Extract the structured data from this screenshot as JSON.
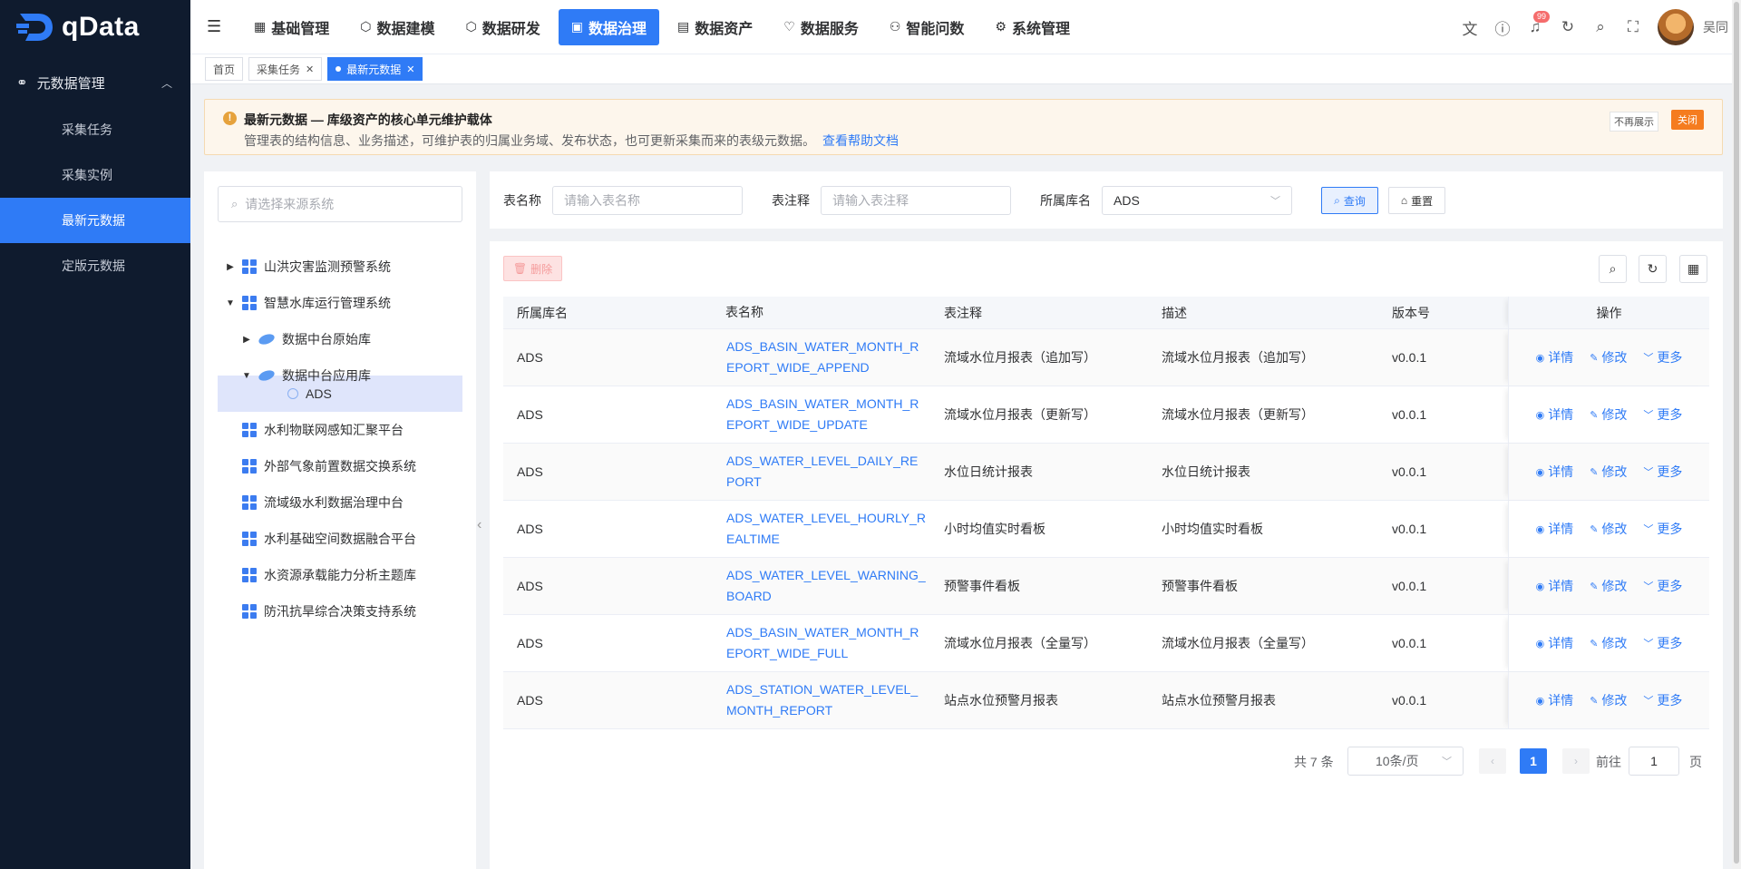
{
  "app": {
    "logo_text": "qData"
  },
  "sidebar": {
    "group_label": "元数据管理",
    "items": [
      {
        "label": "采集任务"
      },
      {
        "label": "采集实例"
      },
      {
        "label": "最新元数据",
        "active": true
      },
      {
        "label": "定版元数据"
      }
    ]
  },
  "topnav": {
    "items": [
      {
        "label": "基础管理",
        "icon": "grid-icon"
      },
      {
        "label": "数据建模",
        "icon": "cube-icon"
      },
      {
        "label": "数据研发",
        "icon": "hexagon-icon"
      },
      {
        "label": "数据治理",
        "icon": "shield-icon",
        "active": true
      },
      {
        "label": "数据资产",
        "icon": "document-icon"
      },
      {
        "label": "数据服务",
        "icon": "heart-icon"
      },
      {
        "label": "智能问数",
        "icon": "robot-icon"
      },
      {
        "label": "系统管理",
        "icon": "gear-icon"
      }
    ],
    "notification_badge": "99",
    "username": "吴同"
  },
  "tabs": [
    {
      "label": "首页"
    },
    {
      "label": "采集任务"
    },
    {
      "label": "最新元数据",
      "active": true
    }
  ],
  "alert": {
    "title": "最新元数据 — 库级资产的核心单元维护载体",
    "description": "管理表的结构信息、业务描述，可维护表的归属业务域、发布状态，也可更新采集而来的表级元数据。",
    "link": "查看帮助文档",
    "hide_label": "不再展示",
    "close_label": "关闭"
  },
  "tree": {
    "search_placeholder": "请选择来源系统",
    "nodes": [
      {
        "label": "山洪灾害监测预警系统"
      },
      {
        "label": "智慧水库运行管理系统"
      },
      {
        "label": "数据中台原始库"
      },
      {
        "label": "数据中台应用库"
      },
      {
        "label": "ADS"
      },
      {
        "label": "水利物联网感知汇聚平台"
      },
      {
        "label": "外部气象前置数据交换系统"
      },
      {
        "label": "流域级水利数据治理中台"
      },
      {
        "label": "水利基础空间数据融合平台"
      },
      {
        "label": "水资源承载能力分析主题库"
      },
      {
        "label": "防汛抗旱综合决策支持系统"
      }
    ]
  },
  "filters": {
    "table_name_label": "表名称",
    "table_name_placeholder": "请输入表名称",
    "table_comment_label": "表注释",
    "table_comment_placeholder": "请输入表注释",
    "db_label": "所属库名",
    "db_value": "ADS",
    "query_label": "查询",
    "reset_label": "重置"
  },
  "table": {
    "delete_label": "删除",
    "columns": [
      "所属库名",
      "表名称",
      "表注释",
      "描述",
      "版本号",
      "操作"
    ],
    "rows": [
      {
        "db": "ADS",
        "name": "ADS_BASIN_WATER_MONTH_REPORT_WIDE_APPEND",
        "comment": "流域水位月报表（追加写）",
        "desc": "流域水位月报表（追加写）",
        "version": "v0.0.1"
      },
      {
        "db": "ADS",
        "name": "ADS_BASIN_WATER_MONTH_REPORT_WIDE_UPDATE",
        "comment": "流域水位月报表（更新写）",
        "desc": "流域水位月报表（更新写）",
        "version": "v0.0.1"
      },
      {
        "db": "ADS",
        "name": "ADS_WATER_LEVEL_DAILY_REPORT",
        "comment": "水位日统计报表",
        "desc": "水位日统计报表",
        "version": "v0.0.1"
      },
      {
        "db": "ADS",
        "name": "ADS_WATER_LEVEL_HOURLY_REALTIME",
        "comment": "小时均值实时看板",
        "desc": "小时均值实时看板",
        "version": "v0.0.1"
      },
      {
        "db": "ADS",
        "name": "ADS_WATER_LEVEL_WARNING_BOARD",
        "comment": "预警事件看板",
        "desc": "预警事件看板",
        "version": "v0.0.1"
      },
      {
        "db": "ADS",
        "name": "ADS_BASIN_WATER_MONTH_REPORT_WIDE_FULL",
        "comment": "流域水位月报表（全量写）",
        "desc": "流域水位月报表（全量写）",
        "version": "v0.0.1"
      },
      {
        "db": "ADS",
        "name": "ADS_STATION_WATER_LEVEL_MONTH_REPORT",
        "comment": "站点水位预警月报表",
        "desc": "站点水位预警月报表",
        "version": "v0.0.1"
      }
    ],
    "actions": {
      "detail": "详情",
      "edit": "修改",
      "more": "更多"
    }
  },
  "pagination": {
    "total_text": "共 7 条",
    "page_size": "10条/页",
    "current_page": "1",
    "goto_label": "前往",
    "goto_value": "1",
    "page_suffix": "页"
  }
}
